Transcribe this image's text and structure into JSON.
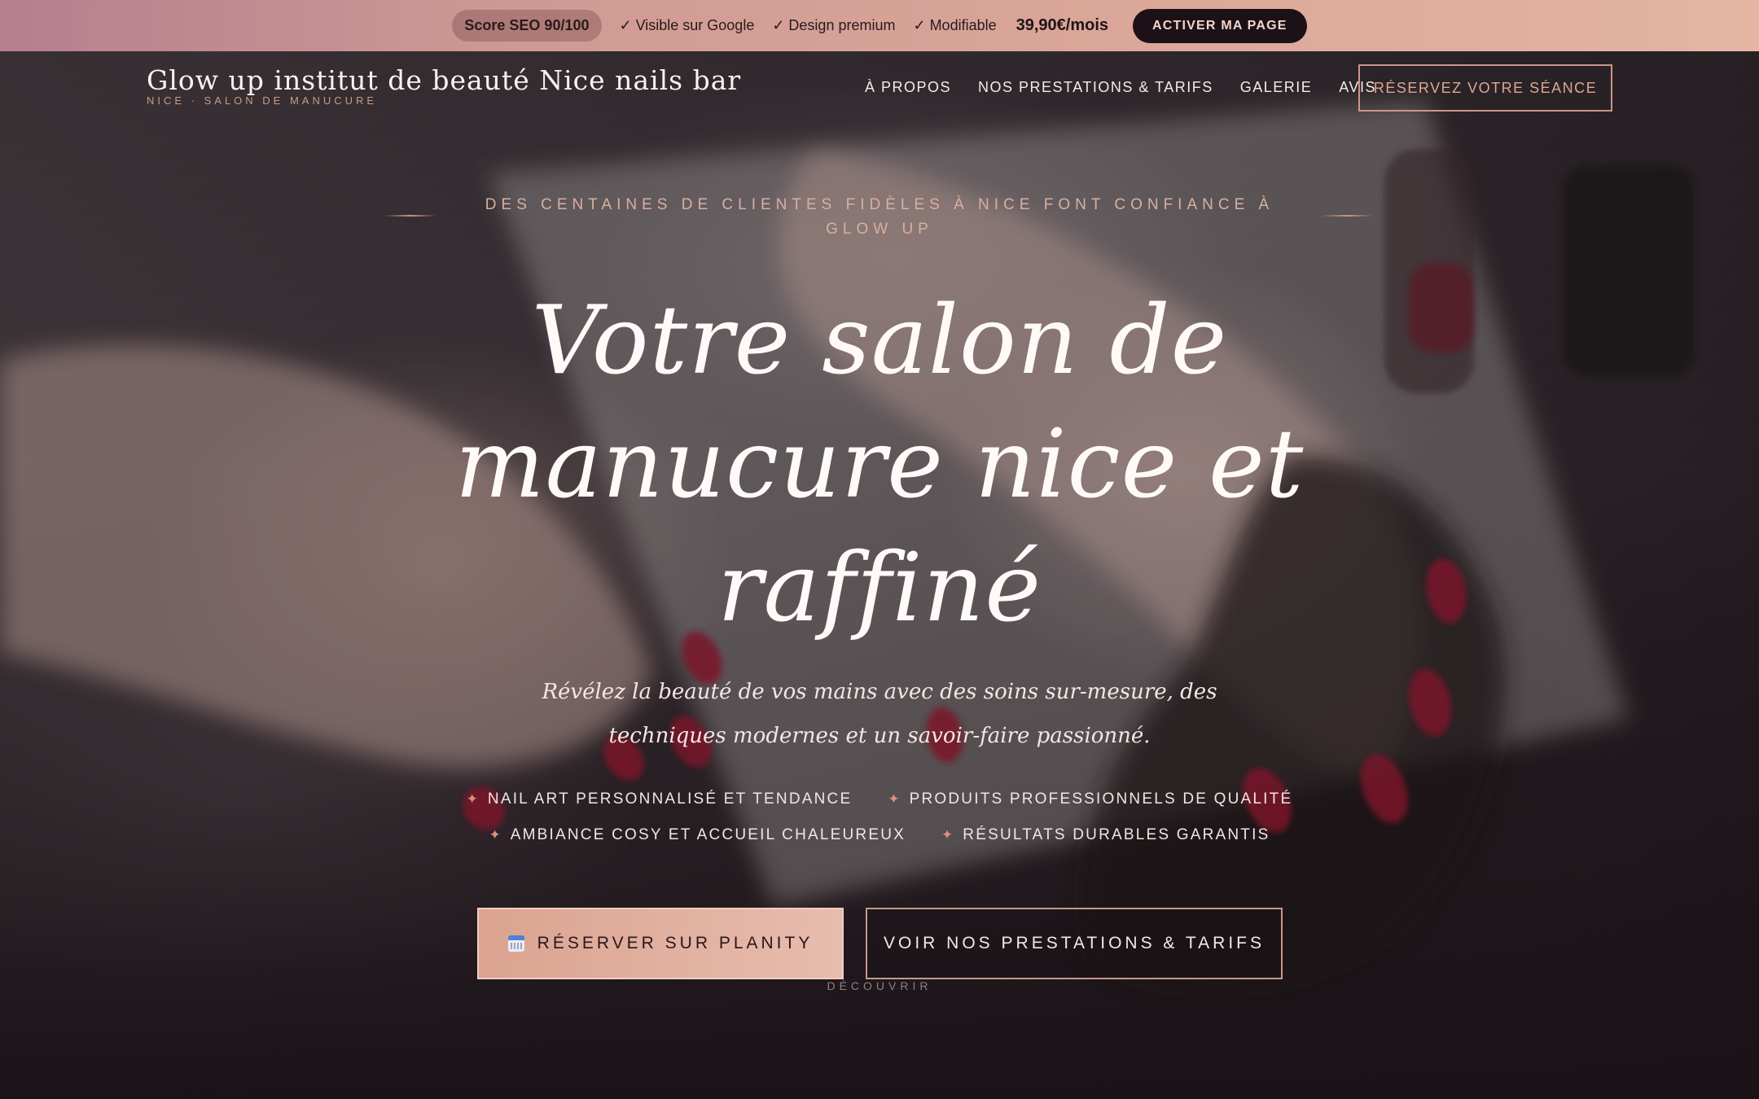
{
  "promo": {
    "score": "Score SEO 90/100",
    "checks": [
      "✓ Visible sur Google",
      "✓ Design premium",
      "✓ Modifiable"
    ],
    "price": "39,90€/mois",
    "cta": "ACTIVER MA PAGE"
  },
  "header": {
    "brand_name": "Glow up institut de beauté Nice nails bar",
    "brand_sub": "NICE · SALON DE MANUCURE",
    "nav": [
      "À PROPOS",
      "NOS PRESTATIONS & TARIFS",
      "GALERIE",
      "AVIS"
    ],
    "cta": "RÉSERVEZ VOTRE SÉANCE"
  },
  "hero": {
    "eyebrow": "DES CENTAINES DE CLIENTES FIDÈLES À NICE FONT CONFIANCE À GLOW UP",
    "headline_lines": [
      "Votre salon de",
      "manucure nice et",
      "raffiné"
    ],
    "subtitle": "Révélez la beauté de vos mains avec des soins sur-mesure, des techniques modernes et un savoir-faire passionné.",
    "features": [
      {
        "icon": "sparkle-icon",
        "text": "NAIL ART PERSONNALISÉ ET TENDANCE"
      },
      {
        "icon": "sparkle-icon",
        "text": "PRODUITS PROFESSIONNELS DE QUALITÉ"
      },
      {
        "icon": "sparkle-icon",
        "text": "AMBIANCE COSY ET ACCUEIL CHALEUREUX"
      },
      {
        "icon": "sparkle-icon",
        "text": "RÉSULTATS DURABLES GARANTIS"
      }
    ],
    "primary_cta": {
      "icon": "calendar-icon",
      "label": "RÉSERVER SUR PLANITY"
    },
    "secondary_cta": "VOIR NOS PRESTATIONS & TARIFS",
    "scroll_hint": "DÉCOUVRIR"
  },
  "colors": {
    "accent": "#c99786",
    "accent_light": "#e7bcae",
    "dark": "#1c1116",
    "promo_gradient_start": "#b57f8f",
    "promo_gradient_end": "#e4b5a2",
    "nail_polish": "#9c1830"
  }
}
